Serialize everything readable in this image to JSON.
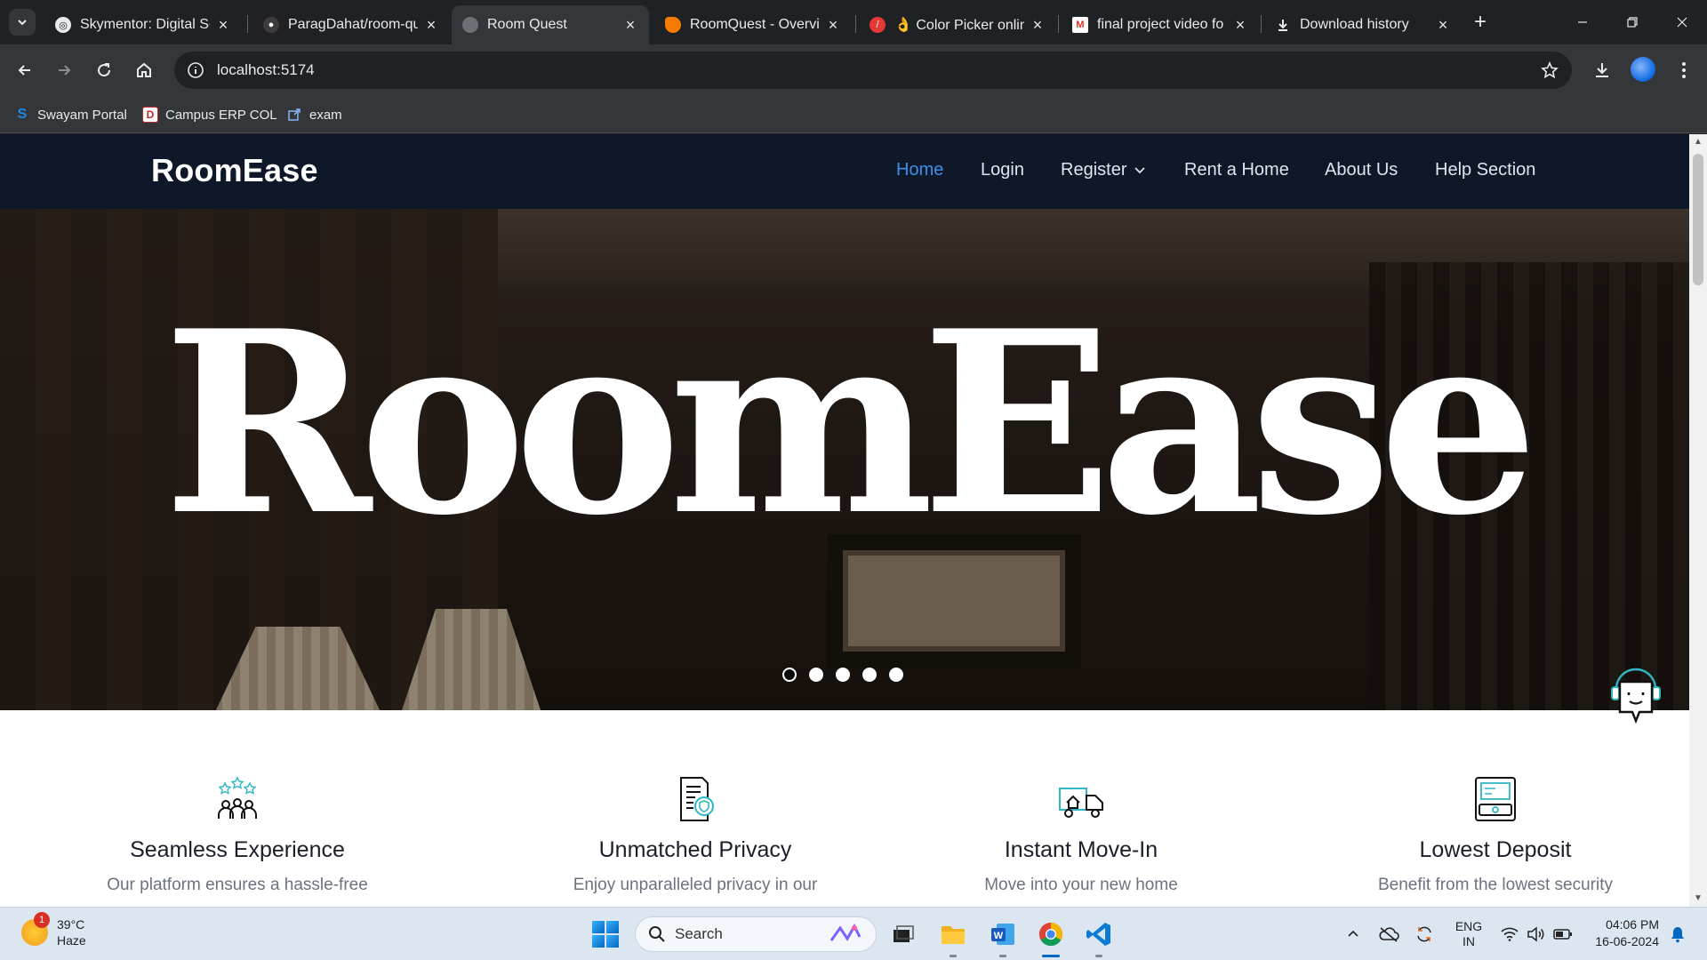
{
  "browser": {
    "tabs": [
      {
        "title": "Skymentor: Digital Sc",
        "favicon": "skymentor-icon",
        "active": false
      },
      {
        "title": "ParagDahat/room-qu",
        "favicon": "github-icon",
        "active": false
      },
      {
        "title": "Room Quest",
        "favicon": "roomquest-icon",
        "active": true
      },
      {
        "title": "RoomQuest - Overvie",
        "favicon": "firebase-icon",
        "active": false
      },
      {
        "title": "👌 Color Picker onlin",
        "favicon": "color-picker-icon",
        "active": false
      },
      {
        "title": "final project video fo",
        "favicon": "gmail-icon",
        "active": false
      },
      {
        "title": "Download history",
        "favicon": "download-icon",
        "active": false
      }
    ],
    "url": "localhost:5174",
    "bookmarks": [
      {
        "label": "Swayam Portal",
        "icon": "swayam-icon"
      },
      {
        "label": "Campus ERP COL",
        "icon": "erp-icon"
      },
      {
        "label": "exam",
        "icon": "external-link-icon"
      }
    ]
  },
  "site": {
    "brand": "RoomEase",
    "nav": [
      {
        "label": "Home",
        "active": true
      },
      {
        "label": "Login",
        "active": false
      },
      {
        "label": "Register",
        "active": false,
        "dropdown": true
      },
      {
        "label": "Rent a Home",
        "active": false
      },
      {
        "label": "About Us",
        "active": false
      },
      {
        "label": "Help Section",
        "active": false
      }
    ],
    "hero": {
      "title": "RoomEase",
      "slides": 5,
      "active_slide": 1
    },
    "features": [
      {
        "title": "Seamless Experience",
        "text": "Our platform ensures a hassle-free",
        "icon": "people-stars-icon"
      },
      {
        "title": "Unmatched Privacy",
        "text": "Enjoy unparalleled privacy in our",
        "icon": "privacy-document-icon"
      },
      {
        "title": "Instant Move-In",
        "text": "Move into your new home",
        "icon": "moving-truck-icon"
      },
      {
        "title": "Lowest Deposit",
        "text": "Benefit from the lowest security",
        "icon": "deposit-card-icon"
      }
    ],
    "chatbot_icon": "chatbot-icon",
    "colors": {
      "nav_bg": "#0f1829",
      "nav_active": "#3b8fe8",
      "icon_accent": "#2fb7c4"
    }
  },
  "taskbar": {
    "weather": {
      "temp": "39°C",
      "condition": "Haze",
      "badge": "1"
    },
    "search_label": "Search",
    "lang": {
      "line1": "ENG",
      "line2": "IN"
    },
    "time": "04:06 PM",
    "date": "16-06-2024"
  }
}
